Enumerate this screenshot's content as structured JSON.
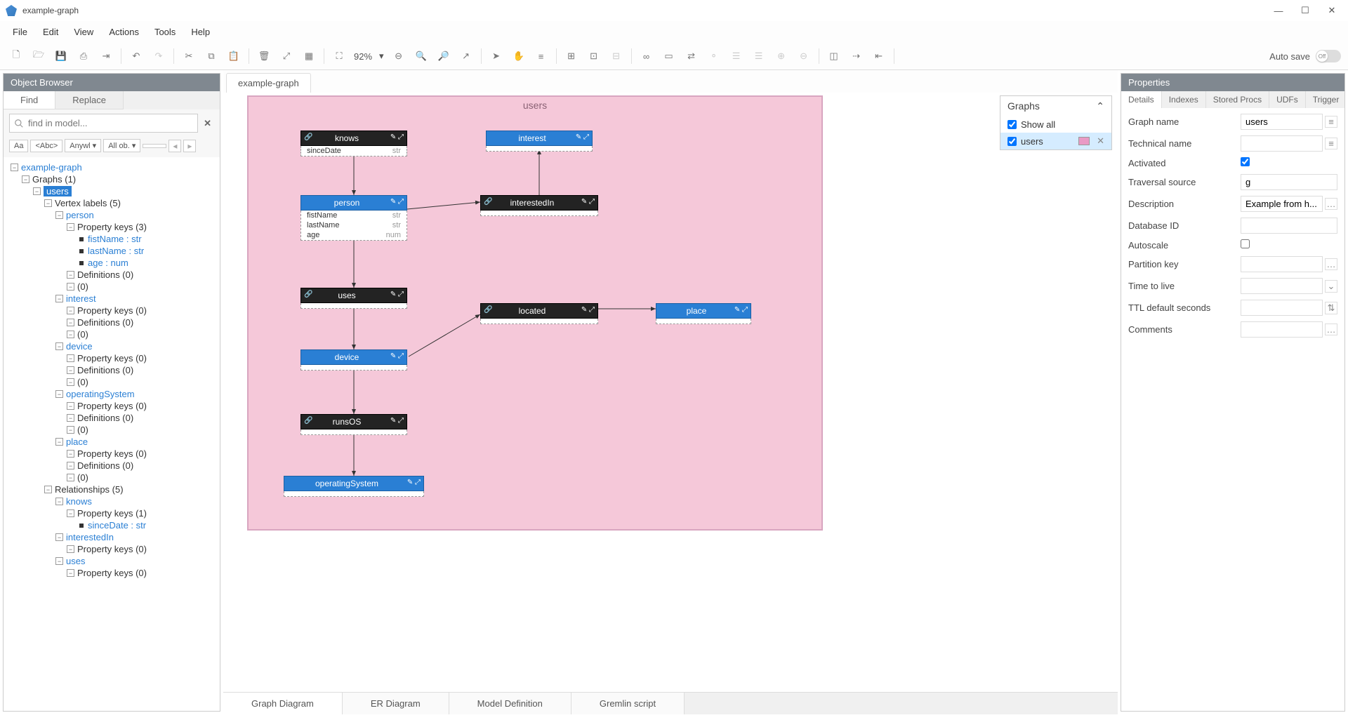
{
  "window": {
    "title": "example-graph"
  },
  "menu": [
    "File",
    "Edit",
    "View",
    "Actions",
    "Tools",
    "Help"
  ],
  "toolbar": {
    "zoom": "92%",
    "autosave_label": "Auto save",
    "autosave_state": "Off"
  },
  "object_browser": {
    "title": "Object Browser",
    "tab_find": "Find",
    "tab_replace": "Replace",
    "search_placeholder": "find in model...",
    "filters": {
      "aa": "Aa",
      "abc": "<Abc>",
      "anywhere": "Anywl",
      "all": "All ob."
    }
  },
  "tree": {
    "root": "example-graph",
    "graphs": "Graphs (1)",
    "users": "users",
    "vertex_labels": "Vertex labels (5)",
    "person": "person",
    "person_pk": "Property keys (3)",
    "fistName": "fistName : str",
    "lastName": "lastName : str",
    "age": "age : num",
    "defs0": "Definitions (0)",
    "zero": "(0)",
    "interest": "interest",
    "pk0": "Property keys (0)",
    "device": "device",
    "operatingSystem": "operatingSystem",
    "place": "place",
    "relationships": "Relationships (5)",
    "knows": "knows",
    "knows_pk": "Property keys (1)",
    "sinceDate": "sinceDate : str",
    "interestedIn": "interestedIn",
    "uses": "uses"
  },
  "center_tab": "example-graph",
  "canvas": {
    "title": "users"
  },
  "nodes": {
    "knows": {
      "title": "knows",
      "props": [
        {
          "k": "sinceDate",
          "t": "str"
        }
      ]
    },
    "interest": {
      "title": "interest"
    },
    "person": {
      "title": "person",
      "props": [
        {
          "k": "fistName",
          "t": "str"
        },
        {
          "k": "lastName",
          "t": "str"
        },
        {
          "k": "age",
          "t": "num"
        }
      ]
    },
    "interestedIn": {
      "title": "interestedIn"
    },
    "uses": {
      "title": "uses"
    },
    "located": {
      "title": "located"
    },
    "place": {
      "title": "place"
    },
    "device": {
      "title": "device"
    },
    "runsOS": {
      "title": "runsOS"
    },
    "operatingSystem": {
      "title": "operatingSystem"
    }
  },
  "graphs_panel": {
    "title": "Graphs",
    "show_all": "Show all",
    "users": "users"
  },
  "bottom_tabs": [
    "Graph Diagram",
    "ER Diagram",
    "Model Definition",
    "Gremlin script"
  ],
  "properties": {
    "title": "Properties",
    "tabs": [
      "Details",
      "Indexes",
      "Stored Procs",
      "UDFs",
      "Trigger"
    ],
    "rows": {
      "graph_name": {
        "label": "Graph name",
        "value": "users"
      },
      "technical_name": {
        "label": "Technical name",
        "value": ""
      },
      "activated": {
        "label": "Activated"
      },
      "traversal": {
        "label": "Traversal source",
        "value": "g"
      },
      "description": {
        "label": "Description",
        "value": "Example from h..."
      },
      "database_id": {
        "label": "Database ID",
        "value": ""
      },
      "autoscale": {
        "label": "Autoscale"
      },
      "partition": {
        "label": "Partition key",
        "value": ""
      },
      "ttl": {
        "label": "Time to live",
        "value": ""
      },
      "ttl_sec": {
        "label": "TTL default seconds",
        "value": ""
      },
      "comments": {
        "label": "Comments",
        "value": ""
      }
    }
  }
}
